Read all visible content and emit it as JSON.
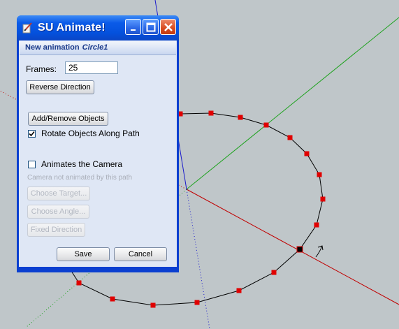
{
  "dialog": {
    "title": "SU Animate!",
    "section_label": "New animation",
    "object_name": "Circle1",
    "frames_label": "Frames:",
    "frames_value": "25",
    "reverse_direction_label": "Reverse Direction",
    "add_remove_label": "Add/Remove Objects",
    "rotate_label": "Rotate Objects Along Path",
    "rotate_checked": true,
    "animate_camera_label": "Animates the Camera",
    "animate_camera_checked": false,
    "camera_note": "Camera not animated by this path",
    "choose_target_label": "Choose Target...",
    "choose_angle_label": "Choose Angle...",
    "fixed_direction_label": "Fixed Direction",
    "save_label": "Save",
    "cancel_label": "Cancel"
  },
  "icons": [
    "app-icon",
    "minimize-icon",
    "maximize-icon",
    "close-icon",
    "check-icon"
  ],
  "colors": {
    "viewport_bg": "#bfc6c9",
    "red_axis": "#c00000",
    "green_axis": "#1ea21e",
    "blue_axis": "#1a1acc",
    "path_point": "#e00000",
    "titlebar": "#0b5be8"
  }
}
